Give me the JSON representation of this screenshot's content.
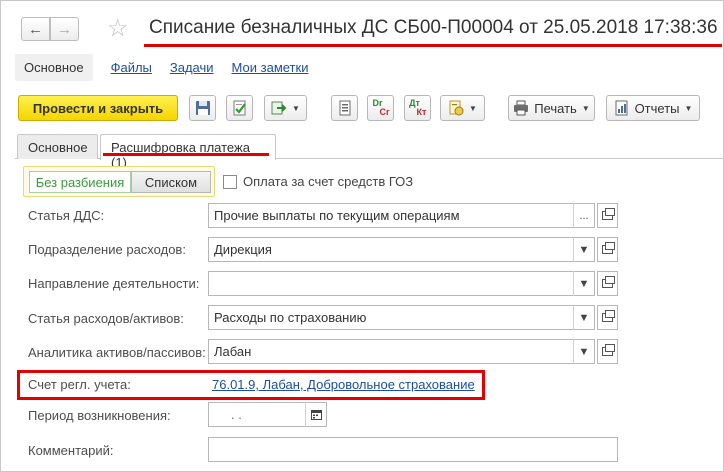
{
  "window": {
    "title": "Списание безналичных ДС СБ00-П00004 от 25.05.2018 17:38:36"
  },
  "navigation": {
    "back_icon": "arrow-left-icon",
    "forward_icon": "arrow-right-icon",
    "favorite_icon": "star-icon"
  },
  "sections": [
    {
      "label": "Основное",
      "active": true
    },
    {
      "label": "Файлы",
      "active": false
    },
    {
      "label": "Задачи",
      "active": false
    },
    {
      "label": "Мои заметки",
      "active": false
    }
  ],
  "toolbar": {
    "post_and_close": "Провести и закрыть",
    "save_icon": "floppy-disk-icon",
    "post_icon": "post-document-icon",
    "create_based_icon": "create-based-on-icon",
    "list_icon": "document-list-icon",
    "journal_dr_top": "Dr",
    "journal_dr_bottom": "Cr",
    "journal_dt_top": "Дт",
    "journal_dt_bottom": "Кт",
    "structure_icon": "report-structure-icon",
    "print_label": "Печать",
    "reports_label": "Отчеты"
  },
  "form_tabs": [
    {
      "label": "Основное",
      "active": false
    },
    {
      "label": "Расшифровка платежа (1)",
      "active": true
    }
  ],
  "split_toggle": {
    "option_a": "Без разбиения",
    "option_b": "Списком",
    "selected": "Без разбиения"
  },
  "goz_checkbox": {
    "label": "Оплата за счет средств ГОЗ",
    "checked": false
  },
  "fields": {
    "cash_flow_item": {
      "label": "Статья ДДС:",
      "value": "Прочие выплаты по текущим операциям"
    },
    "expense_department": {
      "label": "Подразделение расходов:",
      "value": "Дирекция"
    },
    "activity_direction": {
      "label": "Направление деятельности:",
      "value": ""
    },
    "expense_item": {
      "label": "Статья расходов/активов:",
      "value": "Расходы по страхованию"
    },
    "asset_analytics": {
      "label": "Аналитика активов/пассивов:",
      "value": "Лабан"
    },
    "gl_account": {
      "label": "Счет регл. учета:",
      "value": "76.01.9, Лабан, Добровольное страхование"
    },
    "origin_period": {
      "label": "Период возникновения:",
      "value": " .  ."
    },
    "comment": {
      "label": "Комментарий:",
      "value": ""
    }
  },
  "colors": {
    "accent_red": "#e30000",
    "primary_button": "#f5d500",
    "link_blue": "#1c4fa0",
    "toggle_green": "#3b9a3b"
  }
}
